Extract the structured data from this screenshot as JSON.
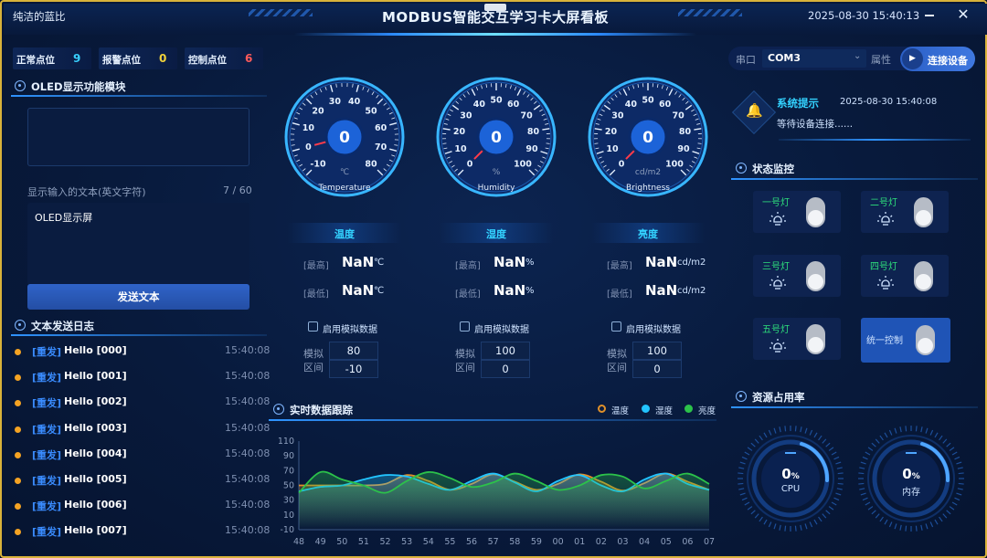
{
  "window": {
    "app_name": "纯洁的蓝比",
    "title": "MODBUS智能交互学习卡大屏看板",
    "datetime": "2025-08-30 15:40:13"
  },
  "counters": [
    {
      "label": "正常点位",
      "value": "9",
      "color": "#38d0ff"
    },
    {
      "label": "报警点位",
      "value": "0",
      "color": "#f0d23a"
    },
    {
      "label": "控制点位",
      "value": "6",
      "color": "#ff5a5a"
    }
  ],
  "oled": {
    "title": "OLED显示功能模块",
    "input_label": "显示输入的文本(英文字符)",
    "char_count": "7 / 60",
    "text_value": "OLED显示屏",
    "send_button": "发送文本"
  },
  "log": {
    "title": "文本发送日志",
    "entries": [
      {
        "tag": "[重发]",
        "msg": "Hello [000]",
        "time": "15:40:08"
      },
      {
        "tag": "[重发]",
        "msg": "Hello [001]",
        "time": "15:40:08"
      },
      {
        "tag": "[重发]",
        "msg": "Hello [002]",
        "time": "15:40:08"
      },
      {
        "tag": "[重发]",
        "msg": "Hello [003]",
        "time": "15:40:08"
      },
      {
        "tag": "[重发]",
        "msg": "Hello [004]",
        "time": "15:40:08"
      },
      {
        "tag": "[重发]",
        "msg": "Hello [005]",
        "time": "15:40:08"
      },
      {
        "tag": "[重发]",
        "msg": "Hello [006]",
        "time": "15:40:08"
      },
      {
        "tag": "[重发]",
        "msg": "Hello [007]",
        "time": "15:40:08"
      }
    ]
  },
  "gauges": [
    {
      "value": "0",
      "unit": "℃",
      "name": "Temperature",
      "min": -10,
      "max": 80,
      "ticks": [
        "-10",
        "0",
        "10",
        "20",
        "30",
        "40",
        "50",
        "60",
        "70",
        "80"
      ],
      "label": "温度",
      "max_label": "[最高]",
      "max_value": "NaN",
      "min_label": "[最低]",
      "min_value": "NaN",
      "sim_label": "启用模拟数据",
      "range_label": "模拟\n区间",
      "range_high": "80",
      "range_low": "-10"
    },
    {
      "value": "0",
      "unit": "%",
      "name": "Humidity",
      "min": 0,
      "max": 100,
      "ticks": [
        "0",
        "10",
        "20",
        "30",
        "40",
        "50",
        "60",
        "70",
        "80",
        "90",
        "100"
      ],
      "label": "湿度",
      "max_label": "[最高]",
      "max_value": "NaN",
      "min_label": "[最低]",
      "min_value": "NaN",
      "sim_label": "启用模拟数据",
      "range_label": "模拟\n区间",
      "range_high": "100",
      "range_low": "0"
    },
    {
      "value": "0",
      "unit": "cd/m2",
      "name": "Brightness",
      "min": 0,
      "max": 100,
      "ticks": [
        "0",
        "10",
        "20",
        "30",
        "40",
        "50",
        "60",
        "70",
        "80",
        "90",
        "100"
      ],
      "label": "亮度",
      "max_label": "[最高]",
      "max_value": "NaN",
      "min_label": "[最低]",
      "min_value": "NaN",
      "sim_label": "启用模拟数据",
      "range_label": "模拟\n区间",
      "range_high": "100",
      "range_low": "0"
    }
  ],
  "trend": {
    "title": "实时数据跟踪",
    "legend": [
      {
        "name": "温度",
        "color": "#e0902a"
      },
      {
        "name": "湿度",
        "color": "#22c4ff"
      },
      {
        "name": "亮度",
        "color": "#2cc24a"
      }
    ]
  },
  "chart_data": {
    "type": "line",
    "x": [
      "48",
      "49",
      "50",
      "51",
      "52",
      "53",
      "54",
      "55",
      "56",
      "57",
      "58",
      "59",
      "00",
      "01",
      "02",
      "03",
      "04",
      "05",
      "06",
      "07"
    ],
    "yticks": [
      "110",
      "90",
      "70",
      "50",
      "30",
      "10",
      "-10"
    ],
    "ylim": [
      -10,
      110
    ],
    "series": [
      {
        "name": "温度",
        "color": "#e0902a",
        "values": [
          50,
          50,
          50,
          50,
          52,
          64,
          56,
          44,
          52,
          65,
          55,
          44,
          52,
          65,
          55,
          43,
          53,
          66,
          55,
          44
        ]
      },
      {
        "name": "湿度",
        "color": "#22c4ff",
        "values": [
          42,
          48,
          50,
          58,
          64,
          62,
          52,
          44,
          56,
          66,
          54,
          42,
          56,
          64,
          50,
          42,
          58,
          66,
          52,
          44
        ]
      },
      {
        "name": "亮度",
        "color": "#2cc24a",
        "values": [
          40,
          68,
          58,
          50,
          40,
          56,
          68,
          60,
          48,
          54,
          66,
          56,
          44,
          50,
          64,
          62,
          46,
          56,
          66,
          52
        ]
      }
    ]
  },
  "connection": {
    "port_label": "串口",
    "port_value": "COM3",
    "attr_label": "属性",
    "connect_button": "连接设备"
  },
  "system": {
    "title": "系统提示",
    "time": "2025-08-30 15:40:08",
    "message": "等待设备连接......"
  },
  "status": {
    "title": "状态监控",
    "lamps": [
      "一号灯",
      "二号灯",
      "三号灯",
      "四号灯",
      "五号灯"
    ],
    "unified_label": "统一控制"
  },
  "resources": {
    "title": "资源占用率",
    "cpu": {
      "value": "0",
      "unit": "%",
      "label": "CPU"
    },
    "mem": {
      "value": "0",
      "unit": "%",
      "label": "内存"
    }
  }
}
